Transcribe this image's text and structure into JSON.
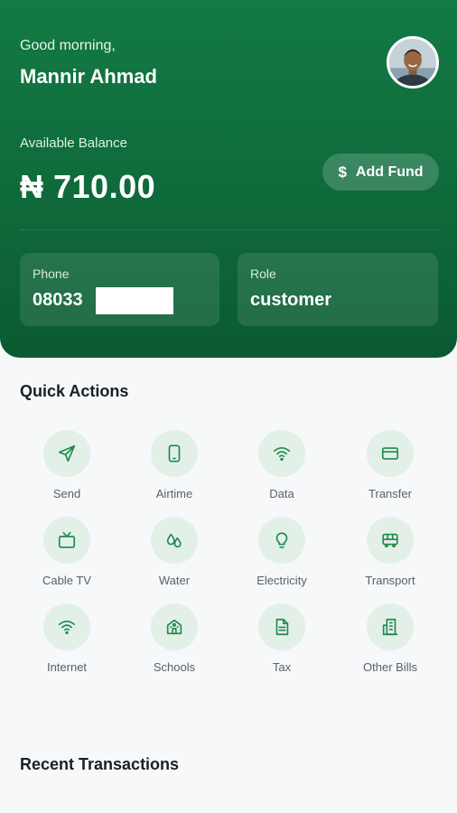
{
  "header": {
    "greeting": "Good morning,",
    "username": "Mannir Ahmad",
    "balance_label": "Available Balance",
    "balance": "₦ 710.00",
    "add_fund_icon": "$",
    "add_fund_label": "Add Fund"
  },
  "cards": {
    "phone_label": "Phone",
    "phone_value": "08033",
    "role_label": "Role",
    "role_value": "customer"
  },
  "quick_actions": {
    "title": "Quick Actions",
    "items": [
      {
        "label": "Send",
        "icon": "send-icon"
      },
      {
        "label": "Airtime",
        "icon": "phone-icon"
      },
      {
        "label": "Data",
        "icon": "wifi-icon"
      },
      {
        "label": "Transfer",
        "icon": "card-icon"
      },
      {
        "label": "Cable TV",
        "icon": "tv-icon"
      },
      {
        "label": "Water",
        "icon": "droplets-icon"
      },
      {
        "label": "Electricity",
        "icon": "lightbulb-icon"
      },
      {
        "label": "Transport",
        "icon": "bus-icon"
      },
      {
        "label": "Internet",
        "icon": "wifi-icon"
      },
      {
        "label": "Schools",
        "icon": "school-icon"
      },
      {
        "label": "Tax",
        "icon": "document-icon"
      },
      {
        "label": "Other Bills",
        "icon": "building-icon"
      }
    ]
  },
  "recent": {
    "title": "Recent Transactions"
  },
  "colors": {
    "primary": "#137a45",
    "icon_green": "#1f8a4c",
    "icon_bg": "#e3f0e8",
    "background": "#f6f8f9"
  }
}
